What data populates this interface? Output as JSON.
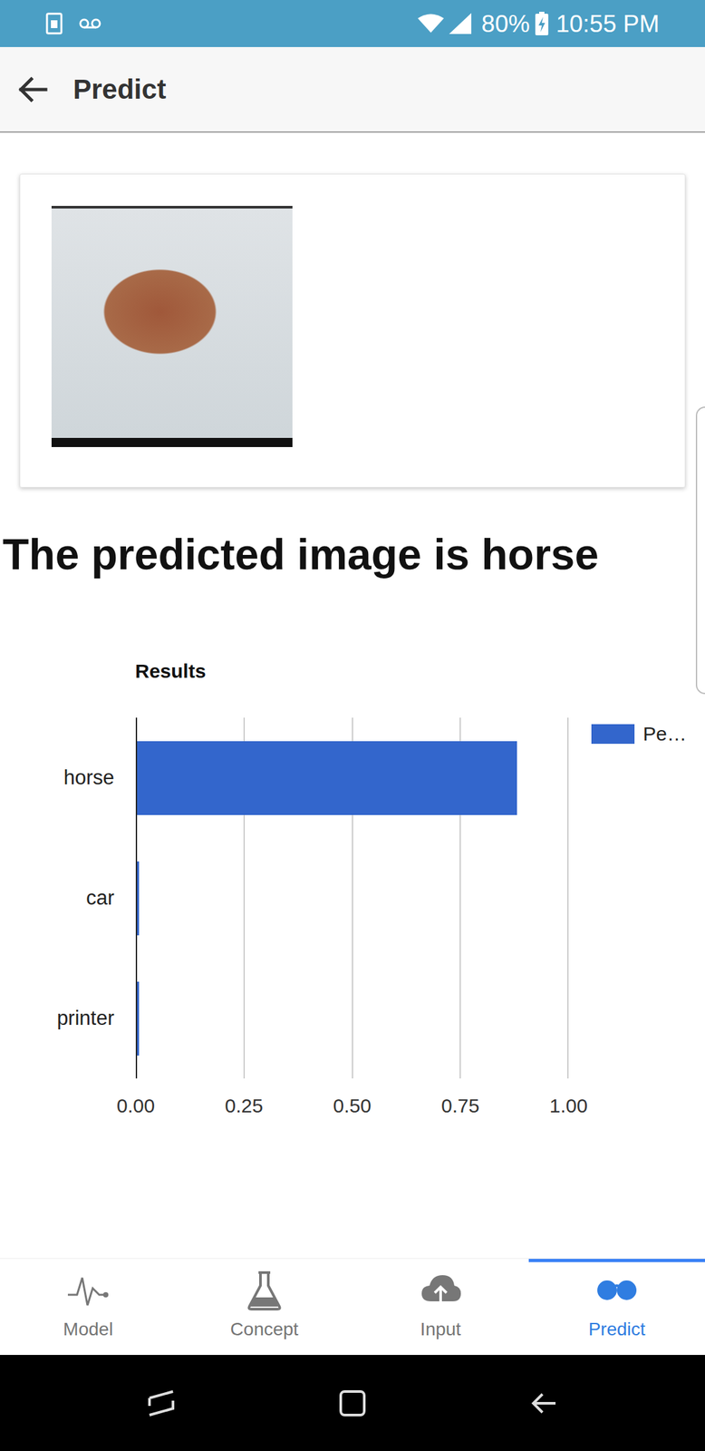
{
  "status_bar": {
    "battery": "80%",
    "time": "10:55 PM"
  },
  "app_bar": {
    "title": "Predict"
  },
  "prediction": {
    "text": "The predicted image is horse"
  },
  "chart": {
    "title": "Results",
    "categories": [
      "horse",
      "car",
      "printer"
    ],
    "series": [
      {
        "name": "Pe…",
        "values": [
          0.88,
          0.005,
          0.005
        ]
      }
    ],
    "ticks": [
      "0.00",
      "0.25",
      "0.50",
      "0.75",
      "1.00"
    ]
  },
  "tabs": [
    {
      "label": "Model",
      "selected": false
    },
    {
      "label": "Concept",
      "selected": false
    },
    {
      "label": "Input",
      "selected": false
    },
    {
      "label": "Predict",
      "selected": true
    }
  ]
}
